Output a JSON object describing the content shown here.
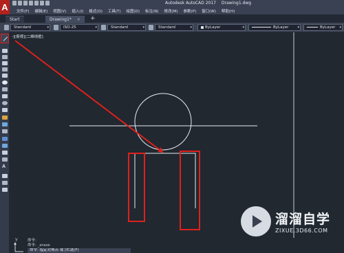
{
  "app": {
    "logo_letter": "A",
    "title_app": "Autodesk AutoCAD 2017",
    "title_file": "Drawing1.dwg"
  },
  "menu": [
    "文件(F)",
    "编辑(E)",
    "视图(V)",
    "插入(I)",
    "格式(O)",
    "工具(T)",
    "绘图(D)",
    "标注(N)",
    "修改(M)",
    "参数(P)",
    "窗口(W)",
    "帮助(H)"
  ],
  "tabs": [
    {
      "label": "Start",
      "active": false
    },
    {
      "label": "Drawing1*",
      "active": true
    }
  ],
  "tab_close": "×",
  "tab_add": "+",
  "toolbar": {
    "text_style": "Standard",
    "dim_style": "ISO-25",
    "table_style": "Standard",
    "mleader_style": "Standard",
    "color": "ByLayer",
    "linetype": "ByLayer",
    "lineweight": "ByLayer",
    "dropdown_arrow": "▾"
  },
  "left_toolbar": {
    "text_tool_letter": "A"
  },
  "canvas": {
    "viewport_label": "-][俯视][二维线框]",
    "background": "#212830",
    "line_color": "#e9ecf2",
    "highlight_color": "#e0201d"
  },
  "command_line": {
    "history": [
      "命令:",
      "命令: _erase"
    ],
    "prompt": "命令: 指定对角点 或 [栏选(F)"
  },
  "ucs": {
    "y_label": "Y"
  },
  "watermark": {
    "title": "溜溜自学",
    "url": "ZIXUE.3D66.COM"
  }
}
